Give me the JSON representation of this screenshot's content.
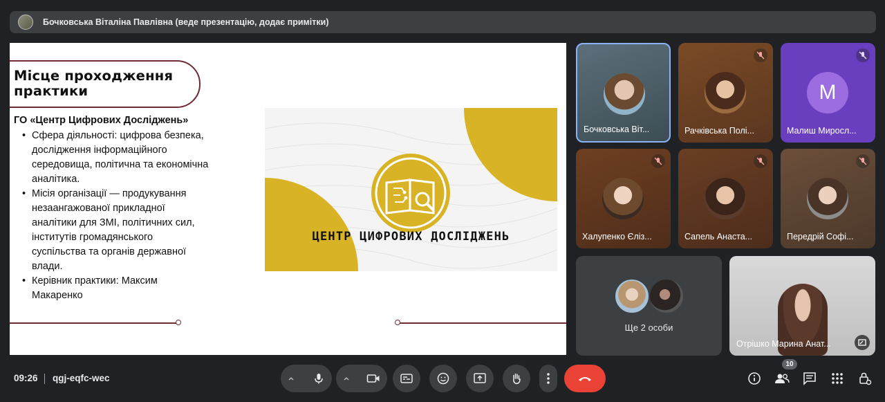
{
  "presenter": {
    "text": "Бочковська Віталіна Павлівна (веде презентацію, додає примітки)"
  },
  "slide": {
    "title": "Місце проходження практики",
    "org_name": "ГО «Центр Цифрових Досліджень»",
    "bullets": [
      "Сфера діяльності: цифрова безпека, дослідження інформаційного середовища, політична та економічна аналітика.",
      "Місія організації —  продукування незаангажованої прикладної аналітики для ЗМІ, політичних сил, інститутів громадянського суспільства та органів державної влади.",
      "Керівник практики: Максим Макаренко"
    ],
    "logo_text": "ЦЕНТР ЦИФРОВИХ ДОСЛІДЖЕНЬ",
    "accent_color": "#d9b326",
    "line_color": "#6e2c33"
  },
  "participants": [
    {
      "name": "Бочковська Віт...",
      "muted": false,
      "active": true
    },
    {
      "name": "Рачківська Полі...",
      "muted": true
    },
    {
      "name": "Малиш Миросл...",
      "muted": true,
      "initial": "M"
    },
    {
      "name": "Халупенко Єліз...",
      "muted": true
    },
    {
      "name": "Сапель Анаста...",
      "muted": true
    },
    {
      "name": "Передрій Софі...",
      "muted": true
    }
  ],
  "more": {
    "label": "Ще 2 особи"
  },
  "self_view": {
    "name": "Отрішко Марина Анат..."
  },
  "bottom": {
    "time": "09:26",
    "meeting_code": "qgj-eqfc-wec",
    "people_count": "10"
  },
  "icons": [
    "mic-icon",
    "camera-icon",
    "captions-icon",
    "emoji-icon",
    "present-icon",
    "hand-icon",
    "more-vert-icon",
    "end-call-icon",
    "info-icon",
    "people-icon",
    "chat-icon",
    "activities-icon",
    "host-controls-icon"
  ]
}
